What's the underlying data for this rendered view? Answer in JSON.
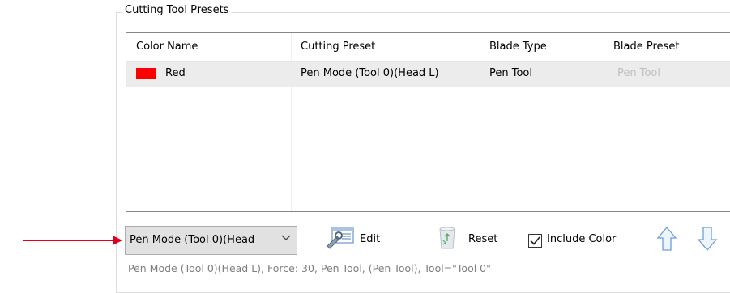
{
  "group": {
    "title": "Cutting Tool Presets"
  },
  "table": {
    "columns": [
      "Color Name",
      "Cutting Preset",
      "Blade Type",
      "Blade Preset"
    ],
    "rows": [
      {
        "color_name": "Red",
        "swatch_color": "#ff0000",
        "cutting_preset": "Pen Mode (Tool 0)(Head L)",
        "blade_type": "Pen Tool",
        "blade_preset": "Pen Tool"
      }
    ]
  },
  "toolbar": {
    "preset_select_value": "Pen Mode (Tool 0)(Head",
    "edit_label": "Edit",
    "reset_label": "Reset",
    "include_color_label": "Include Color",
    "include_color_checked": true
  },
  "status_text": "Pen Mode (Tool 0)(Head L), Force: 30, Pen Tool, (Pen Tool), Tool=\"Tool 0\"",
  "annotation": {
    "arrow_color": "#e0001b"
  }
}
